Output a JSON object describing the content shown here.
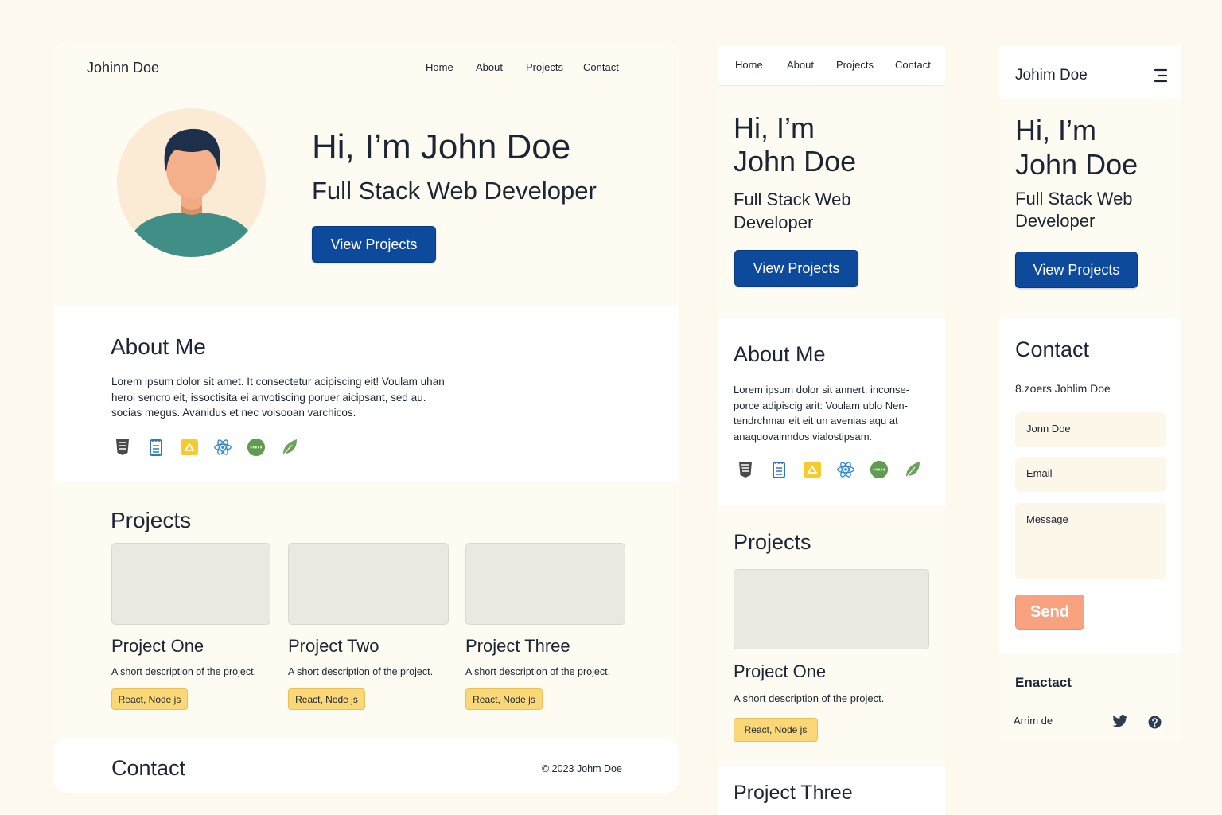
{
  "desktop": {
    "brand": "Johinn Doe",
    "nav": [
      "Home",
      "About",
      "Projects",
      "Contact"
    ],
    "hero": {
      "title": "Hi, I’m John Doe",
      "subtitle": "Full Stack Web Developer",
      "cta": "View Projects"
    },
    "about": {
      "heading": "About Me",
      "lines": [
        "Lorem ipsum dolor sit amet. It consectetur acipiscing eit! Voulam uhan",
        "heroi sencro eit, issoctisita ei anvotiscing poruer aicipsant, sed au.",
        "socias megus. Avanidus et nec voisooan varchicos."
      ]
    },
    "projects": {
      "heading": "Projects",
      "items": [
        {
          "title": "Project One",
          "desc": "A short description of the project.",
          "tag": "React, Node js"
        },
        {
          "title": "Project Two",
          "desc": "A short description of the project.",
          "tag": "React, Node js"
        },
        {
          "title": "Project Three",
          "desc": "A short description of the project.",
          "tag": "React, Node js"
        }
      ]
    },
    "contact": {
      "heading": "Contact",
      "copyright": "© 2023 Johm Doe"
    }
  },
  "tablet": {
    "nav": [
      "Home",
      "About",
      "Projects",
      "Contact"
    ],
    "hero": {
      "title_line1": "Hi, I’m",
      "title_line2": "John Doe",
      "subtitle_line1": "Full Stack Web",
      "subtitle_line2": "Developer",
      "cta": "View Projects"
    },
    "about": {
      "heading": "About Me",
      "lines": [
        "Lorem ipsum dolor sit annert, inconse-",
        "porce adipiscig arit: Voulam ublo Nen-",
        "tendrchmar eit eit un avenias aqu at",
        "anaquovainndos vialostipsam."
      ]
    },
    "projects": {
      "heading": "Projects",
      "item": {
        "title": "Project One",
        "desc": "A short description of the project.",
        "tag": "React, Node js"
      },
      "next_title": "Project Three"
    }
  },
  "mobile": {
    "brand": "Johim Doe",
    "hero": {
      "title_line1": "Hi, I’m",
      "title_line2": "John Doe",
      "subtitle_line1": "Full Stack Web",
      "subtitle_line2": "Developer",
      "cta": "View Projects"
    },
    "contact": {
      "heading": "Contact",
      "subtext": "8.zoers Johlim Doe",
      "name_value": "Jonn Doe",
      "email_placeholder": "Email",
      "message_placeholder": "Message",
      "send": "Send"
    },
    "footer": {
      "heading": "Enactact",
      "name": "Arrim de"
    }
  },
  "colors": {
    "accent": "#0d4a9c",
    "send": "#f8a27f",
    "tag": "#fbd877",
    "page_bg": "#fdf9ef"
  },
  "icons": [
    "html5-icon",
    "css3-icon",
    "javascript-icon",
    "react-icon",
    "nodejs-icon",
    "mongodb-leaf-icon"
  ]
}
